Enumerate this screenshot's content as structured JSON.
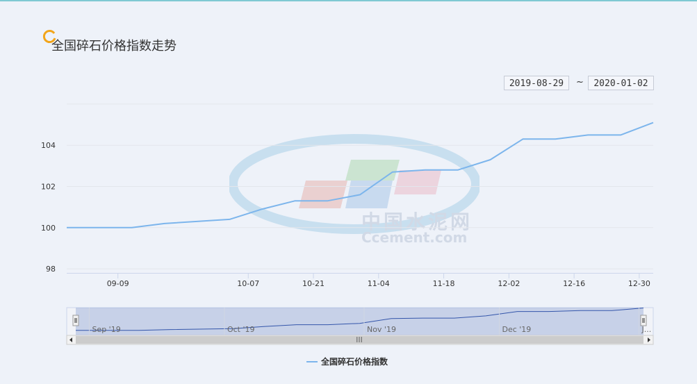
{
  "panel": {
    "title": "全国碎石价格指数走势"
  },
  "date_range": {
    "start": "2019-08-29",
    "separator": "~",
    "end": "2020-01-02"
  },
  "watermark": {
    "cn": "中国水泥网",
    "en": "Ccement.com"
  },
  "navigator_labels": [
    "Sep '19",
    "Oct '19",
    "Nov '19",
    "Dec '19",
    "J..."
  ],
  "navigator_scroll_grip": "III",
  "chart_data": {
    "type": "line",
    "x": [
      "2019-08-29",
      "2019-09-12",
      "2019-09-19",
      "2019-10-03",
      "2019-10-10",
      "2019-10-17",
      "2019-10-24",
      "2019-10-31",
      "2019-11-07",
      "2019-11-14",
      "2019-11-21",
      "2019-11-28",
      "2019-12-05",
      "2019-12-12",
      "2019-12-19",
      "2019-12-26",
      "2020-01-02"
    ],
    "series": [
      {
        "name": "全国碎石价格指数",
        "values": [
          100.0,
          100.0,
          100.2,
          100.4,
          100.9,
          101.3,
          101.3,
          101.6,
          102.7,
          102.8,
          102.8,
          103.3,
          104.3,
          104.3,
          104.5,
          104.5,
          105.1
        ],
        "color": "#7cb5ec"
      }
    ],
    "y_ticks": [
      98,
      100,
      102,
      104
    ],
    "x_ticks": [
      "09-09",
      "10-07",
      "10-21",
      "11-04",
      "11-18",
      "12-02",
      "12-16",
      "12-30"
    ],
    "ylim": [
      97.8,
      106.2
    ],
    "xlim": [
      "2019-08-29",
      "2020-01-02"
    ],
    "grid": true,
    "legend": "bottom-center"
  }
}
